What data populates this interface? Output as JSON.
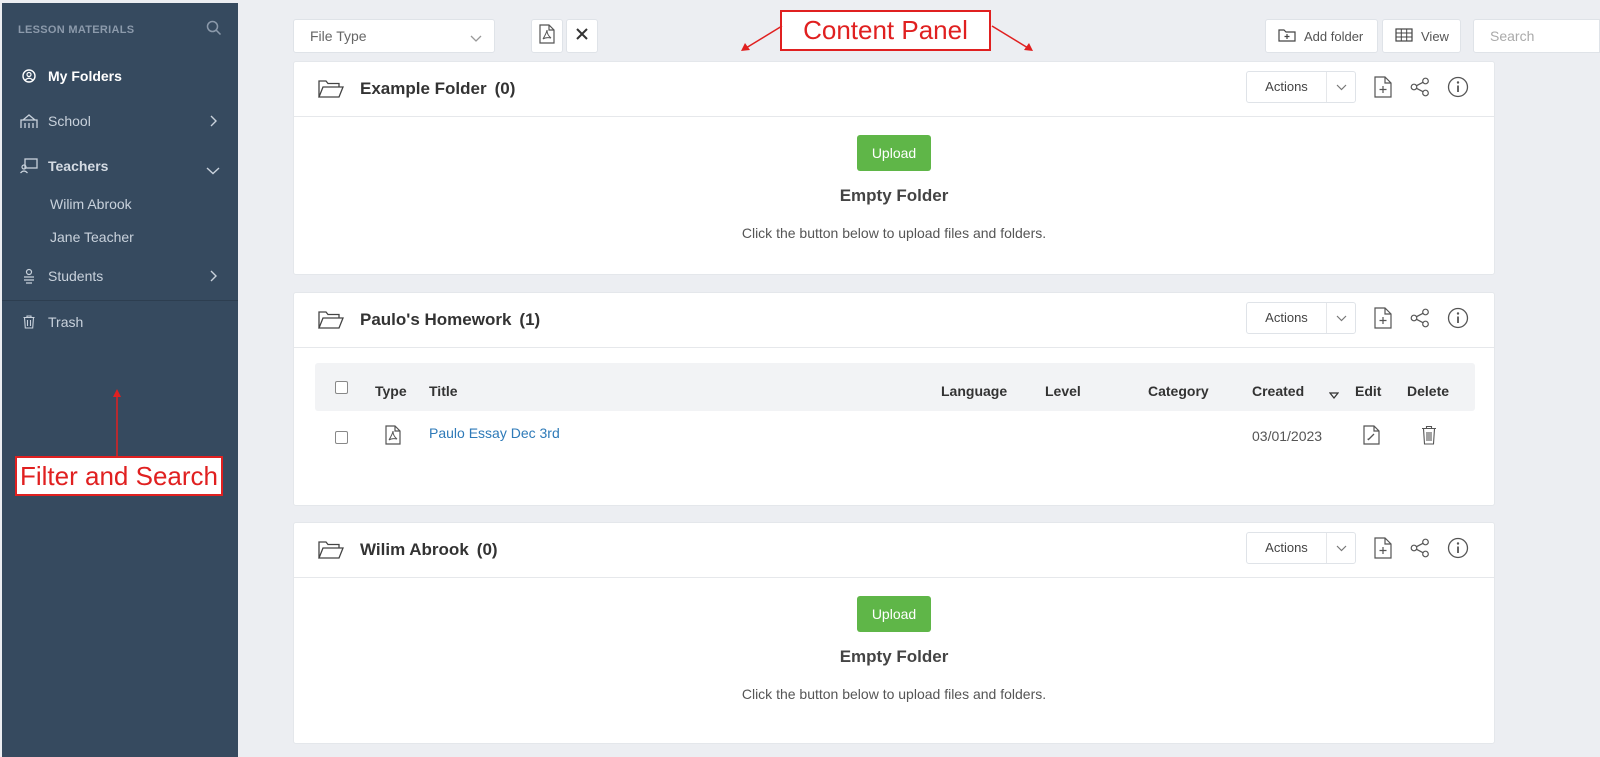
{
  "sidebar": {
    "heading": "LESSON MATERIALS",
    "items": [
      {
        "label": "My Folders"
      },
      {
        "label": "School"
      },
      {
        "label": "Teachers"
      },
      {
        "label": "Wilim Abrook"
      },
      {
        "label": "Jane Teacher"
      },
      {
        "label": "Students"
      },
      {
        "label": "Trash"
      }
    ]
  },
  "annotations": {
    "filter": "Filter and Search",
    "content": "Content Panel"
  },
  "toolbar": {
    "file_type": "File Type",
    "add_folder": "Add folder",
    "view": "View",
    "search_placeholder": "Search"
  },
  "folders": [
    {
      "title": "Example Folder",
      "count": "(0)",
      "actions": "Actions",
      "upload": "Upload",
      "empty_title": "Empty Folder",
      "empty_text": "Click the button below to upload files and folders."
    },
    {
      "title": "Paulo's Homework",
      "count": "(1)",
      "actions": "Actions",
      "columns": [
        "Type",
        "Title",
        "Language",
        "Level",
        "Category",
        "Created",
        "Edit",
        "Delete"
      ],
      "rows": [
        {
          "title": "Paulo Essay Dec 3rd",
          "language": "",
          "level": "",
          "category": "",
          "created": "03/01/2023"
        }
      ]
    },
    {
      "title": "Wilim Abrook",
      "count": "(0)",
      "actions": "Actions",
      "upload": "Upload",
      "empty_title": "Empty Folder",
      "empty_text": "Click the button below to upload files and folders."
    }
  ],
  "colors": {
    "sidebar_bg": "#364a5f",
    "accent_green": "#5fb648",
    "link_blue": "#2e7ab8",
    "annotation_red": "#e02020"
  }
}
